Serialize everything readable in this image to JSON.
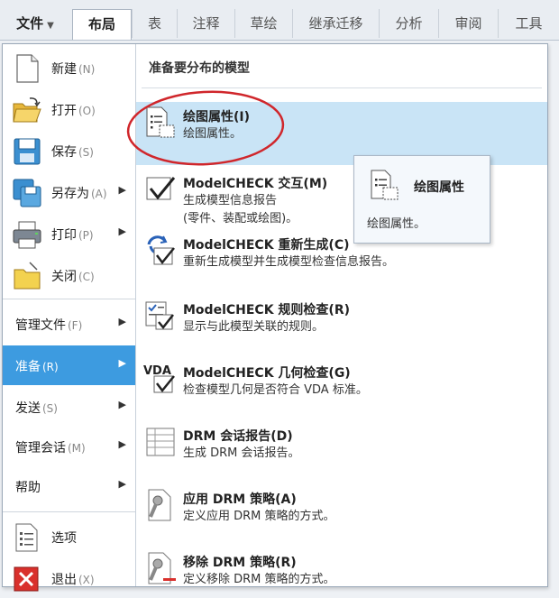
{
  "tabs": {
    "file": "文件",
    "items": [
      "布局",
      "表",
      "注释",
      "草绘",
      "继承迁移",
      "分析",
      "审阅",
      "工具"
    ],
    "active_index": 0
  },
  "left_menu": {
    "new": {
      "label": "新建",
      "shortcut": "(N)"
    },
    "open": {
      "label": "打开",
      "shortcut": "(O)"
    },
    "save": {
      "label": "保存",
      "shortcut": "(S)"
    },
    "save_as": {
      "label": "另存为",
      "shortcut": "(A)"
    },
    "print": {
      "label": "打印",
      "shortcut": "(P)"
    },
    "close": {
      "label": "关闭",
      "shortcut": "(C)"
    },
    "manage_file": {
      "label": "管理文件",
      "shortcut": "(F)"
    },
    "prepare": {
      "label": "准备",
      "shortcut": "(R)"
    },
    "send": {
      "label": "发送",
      "shortcut": "(S)"
    },
    "manage_session": {
      "label": "管理会话",
      "shortcut": "(M)"
    },
    "help": {
      "label": "帮助"
    },
    "options": {
      "label": "选项"
    },
    "exit": {
      "label": "退出",
      "shortcut": "(X)"
    }
  },
  "right_pane": {
    "title": "准备要分布的模型",
    "items": [
      {
        "title": "绘图属性(I)",
        "desc": "绘图属性。"
      },
      {
        "title": "ModelCHECK 交互(M)",
        "desc": "生成模型信息报告\n(零件、装配或绘图)。"
      },
      {
        "title": "ModelCHECK 重新生成(C)",
        "desc": "重新生成模型并生成模型检查信息报告。"
      },
      {
        "title": "ModelCHECK 规则检查(R)",
        "desc": "显示与此模型关联的规则。"
      },
      {
        "title": "ModelCHECK 几何检查(G)",
        "desc": "检查模型几何是否符合 VDA 标准。"
      },
      {
        "title": "DRM 会话报告(D)",
        "desc": "生成 DRM 会话报告。"
      },
      {
        "title": "应用 DRM 策略(A)",
        "desc": "定义应用 DRM 策略的方式。"
      },
      {
        "title": "移除 DRM 策略(R)",
        "desc": "定义移除 DRM 策略的方式。"
      }
    ],
    "vda_label": "VDA"
  },
  "tooltip": {
    "title": "绘图属性",
    "desc": "绘图属性。"
  },
  "colors": {
    "selected": "#3d9be0",
    "highlight": "#c9e4f6",
    "annotation": "#d0262b"
  }
}
